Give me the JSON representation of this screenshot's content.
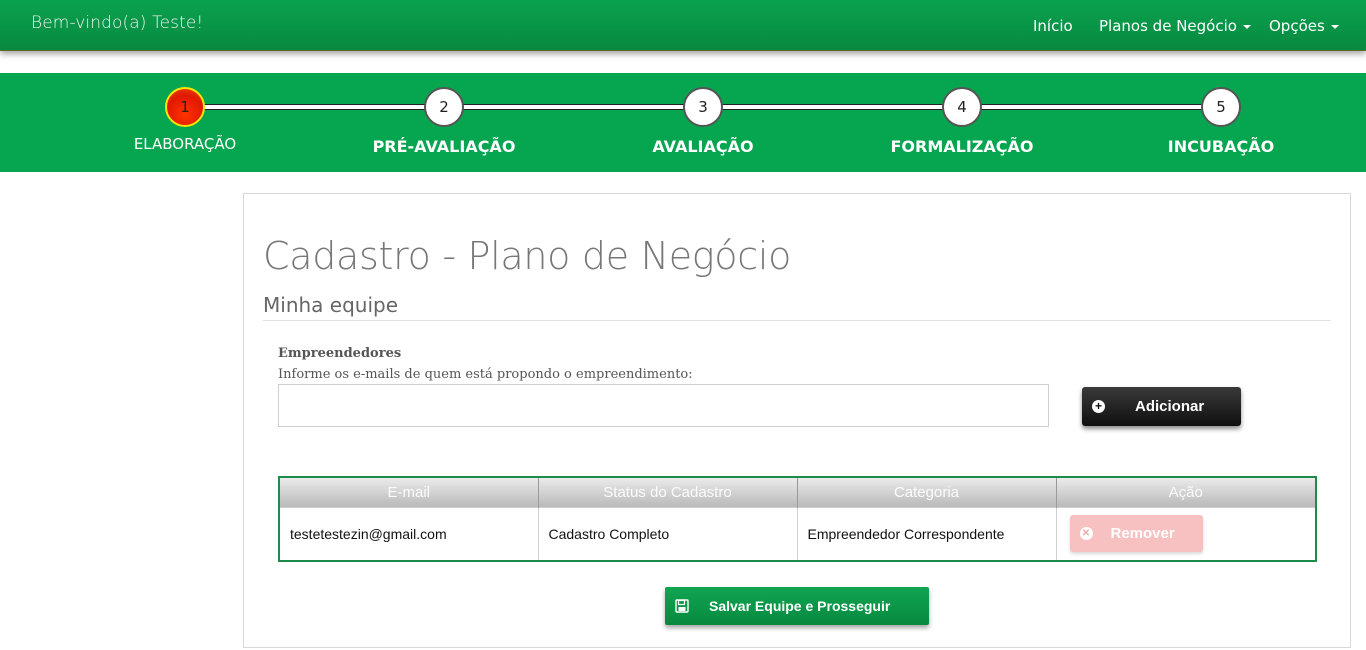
{
  "navbar": {
    "brand": "Bem-vindo(a) Teste!",
    "links": {
      "inicio": "Início",
      "planos": "Planos de Negócio",
      "opcoes": "Opções"
    }
  },
  "stepper": {
    "current_step": 1,
    "steps": [
      {
        "number": "1",
        "label": "ELABORAÇÃO"
      },
      {
        "number": "2",
        "label": "PRÉ-AVALIAÇÃO"
      },
      {
        "number": "3",
        "label": "AVALIAÇÃO"
      },
      {
        "number": "4",
        "label": "FORMALIZAÇÃO"
      },
      {
        "number": "5",
        "label": "INCUBAÇÃO"
      }
    ]
  },
  "main": {
    "title": "Cadastro - Plano de Negócio",
    "subtitle": "Minha equipe",
    "form": {
      "label": "Empreendedores",
      "help": "Informe os e-mails de quem está propondo o empreendimento:",
      "email_value": "",
      "add_button": "Adicionar"
    },
    "table": {
      "columns": [
        "E-mail",
        "Status do Cadastro",
        "Categoria",
        "Ação"
      ],
      "rows": [
        {
          "email": "testetestezin@gmail.com",
          "status": "Cadastro Completo",
          "categoria": "Empreendedor Correspondente",
          "action": "Remover"
        }
      ]
    },
    "save_button": "Salvar Equipe e Prosseguir"
  },
  "colors": {
    "brand_green": "#06a550",
    "active_step": "#e01800",
    "remove_button": "#f8c1c1"
  },
  "icons": {
    "add": "plus-circle-icon",
    "remove": "times-circle-icon",
    "save": "floppy-disk-icon",
    "dropdown": "caret-down-icon"
  }
}
